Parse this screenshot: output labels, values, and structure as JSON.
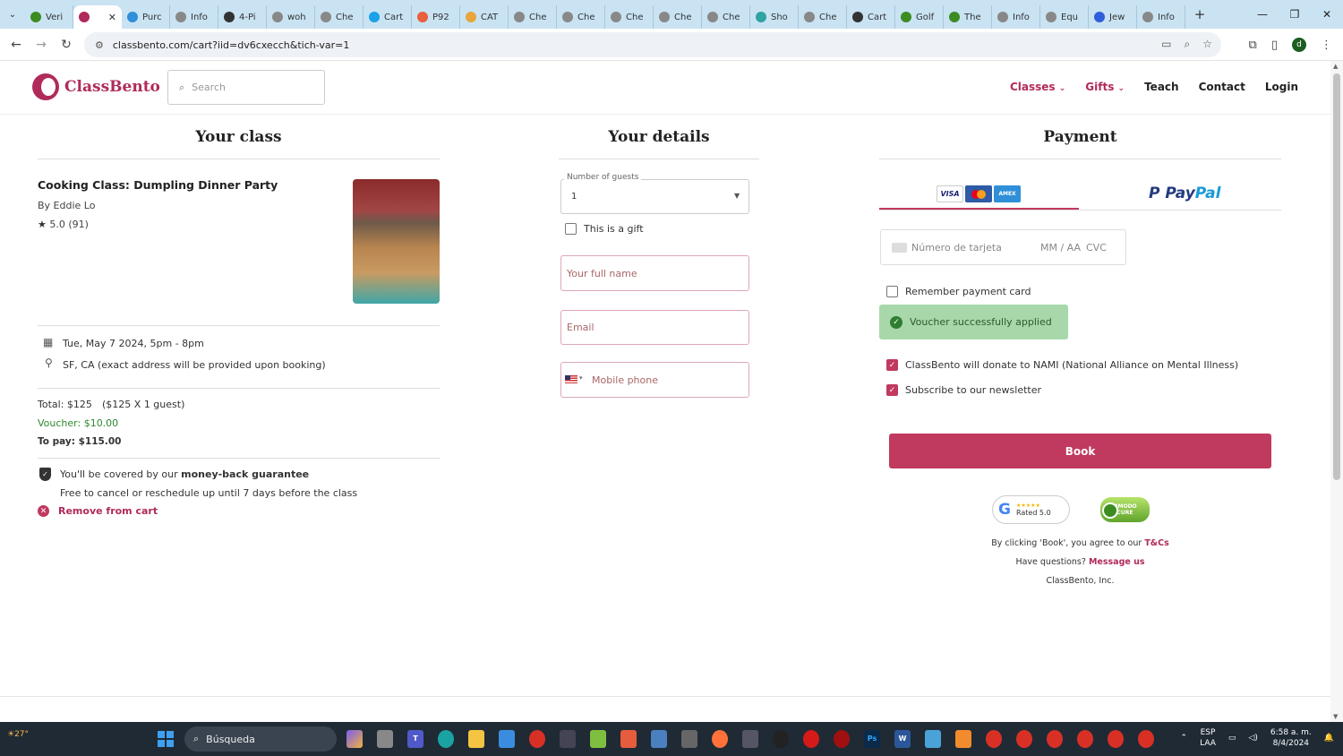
{
  "browser": {
    "tabs": [
      {
        "label": "Veri",
        "color": "#3c8c22"
      },
      {
        "label": "",
        "color": "#b02a5b",
        "active": true
      },
      {
        "label": "Purc",
        "color": "#2f8fd8"
      },
      {
        "label": "Info",
        "color": "#888888"
      },
      {
        "label": "4-Pi",
        "color": "#333333"
      },
      {
        "label": "woh",
        "color": "#888888"
      },
      {
        "label": "Che",
        "color": "#888888"
      },
      {
        "label": "Cart",
        "color": "#1aa1e8"
      },
      {
        "label": "P92",
        "color": "#e8603c"
      },
      {
        "label": "CAT",
        "color": "#e8a53c"
      },
      {
        "label": "Che",
        "color": "#888888"
      },
      {
        "label": "Che",
        "color": "#888888"
      },
      {
        "label": "Che",
        "color": "#888888"
      },
      {
        "label": "Che",
        "color": "#888888"
      },
      {
        "label": "Che",
        "color": "#888888"
      },
      {
        "label": "Sho",
        "color": "#2fa2a2"
      },
      {
        "label": "Che",
        "color": "#888888"
      },
      {
        "label": "Cart",
        "color": "#333333"
      },
      {
        "label": "Golf",
        "color": "#3c8c22"
      },
      {
        "label": "The",
        "color": "#3c8c22"
      },
      {
        "label": "Info",
        "color": "#888888"
      },
      {
        "label": "Equ",
        "color": "#888888"
      },
      {
        "label": "Jew",
        "color": "#2f5fd8"
      },
      {
        "label": "Info",
        "color": "#888888"
      }
    ],
    "url": "classbento.com/cart?iid=dv6cxecch&tich-var=1",
    "profile_initial": "d"
  },
  "header": {
    "logo_text": "ClassBento",
    "search_placeholder": "Search",
    "nav": {
      "classes": "Classes",
      "gifts": "Gifts",
      "teach": "Teach",
      "contact": "Contact",
      "login": "Login"
    }
  },
  "your_class": {
    "heading": "Your class",
    "title": "Cooking Class: Dumpling Dinner Party",
    "by": "By Eddie Lo",
    "rating": "5.0 (91)",
    "date": "Tue, May 7 2024, 5pm - 8pm",
    "location": "SF, CA (exact address will be provided upon booking)",
    "total_label": "Total: $125",
    "total_detail": "($125 X 1 guest)",
    "voucher": "Voucher: $10.00",
    "to_pay": "To pay: $115.00",
    "covered_prefix": "You'll be covered by our",
    "covered_bold": "money-back guarantee",
    "cancel_text": "Free to cancel or reschedule up until 7 days before the class",
    "remove": "Remove from cart"
  },
  "your_details": {
    "heading": "Your details",
    "guests_label": "Number of guests",
    "guests_value": "1",
    "gift_label": "This is a gift",
    "name_placeholder": "Your full name",
    "email_placeholder": "Email",
    "phone_placeholder": "Mobile phone"
  },
  "payment": {
    "heading": "Payment",
    "paypal_a": "Pay",
    "paypal_b": "Pal",
    "card_placeholder": "Número de tarjeta",
    "expiry_placeholder": "MM / AA",
    "cvc_placeholder": "CVC",
    "remember_label": "Remember payment card",
    "voucher_status": "Voucher successfully applied",
    "donate_label": "ClassBento will donate to NAMI (National Alliance on Mental Illness)",
    "newsletter_label": "Subscribe to our newsletter",
    "book_label": "Book",
    "google_rated": "Rated 5.0",
    "secure_text": "COMODO SECURE",
    "terms_prefix": "By clicking 'Book', you agree to our",
    "terms_link": "T&Cs",
    "questions_prefix": "Have questions?",
    "message_link": "Message us",
    "company": "ClassBento, Inc."
  },
  "taskbar": {
    "temperature": "27°",
    "search_label": "Búsqueda",
    "lang_top": "ESP",
    "lang_bottom": "LAA",
    "time": "6:58 a. m.",
    "date": "8/4/2024"
  },
  "colors": {
    "brand": "#b02a5b",
    "button": "#c0395f",
    "voucher_bg": "#a8d8aa"
  }
}
